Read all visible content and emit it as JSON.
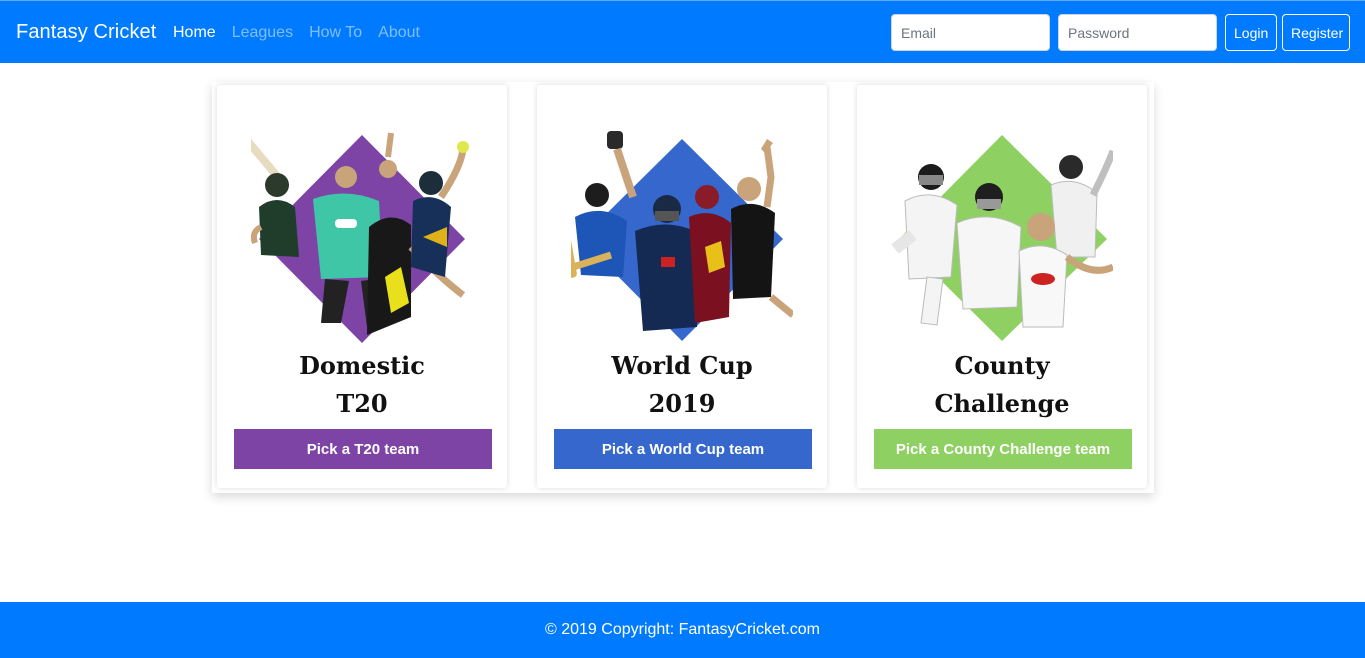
{
  "navbar": {
    "brand": "Fantasy Cricket",
    "links": [
      {
        "label": "Home",
        "active": true
      },
      {
        "label": "Leagues",
        "active": false
      },
      {
        "label": "How To",
        "active": false
      },
      {
        "label": "About",
        "active": false
      }
    ],
    "email_placeholder": "Email",
    "password_placeholder": "Password",
    "login_label": "Login",
    "register_label": "Register"
  },
  "cards": [
    {
      "title_line1": "Domestic",
      "title_line2": "T20",
      "button_label": "Pick a T20 team",
      "accent": "#7d44a6",
      "icon": "t20-players-diamond-icon"
    },
    {
      "title_line1": "World Cup",
      "title_line2": "2019",
      "button_label": "Pick a World Cup team",
      "accent": "#3567cd",
      "icon": "world-cup-players-diamond-icon"
    },
    {
      "title_line1": "County",
      "title_line2": "Challenge",
      "button_label": "Pick a County Challenge team",
      "accent": "#8fd063",
      "icon": "county-players-diamond-icon"
    }
  ],
  "footer": {
    "text": "© 2019 Copyright: FantasyCricket.com"
  },
  "colors": {
    "primary": "#007bff"
  }
}
